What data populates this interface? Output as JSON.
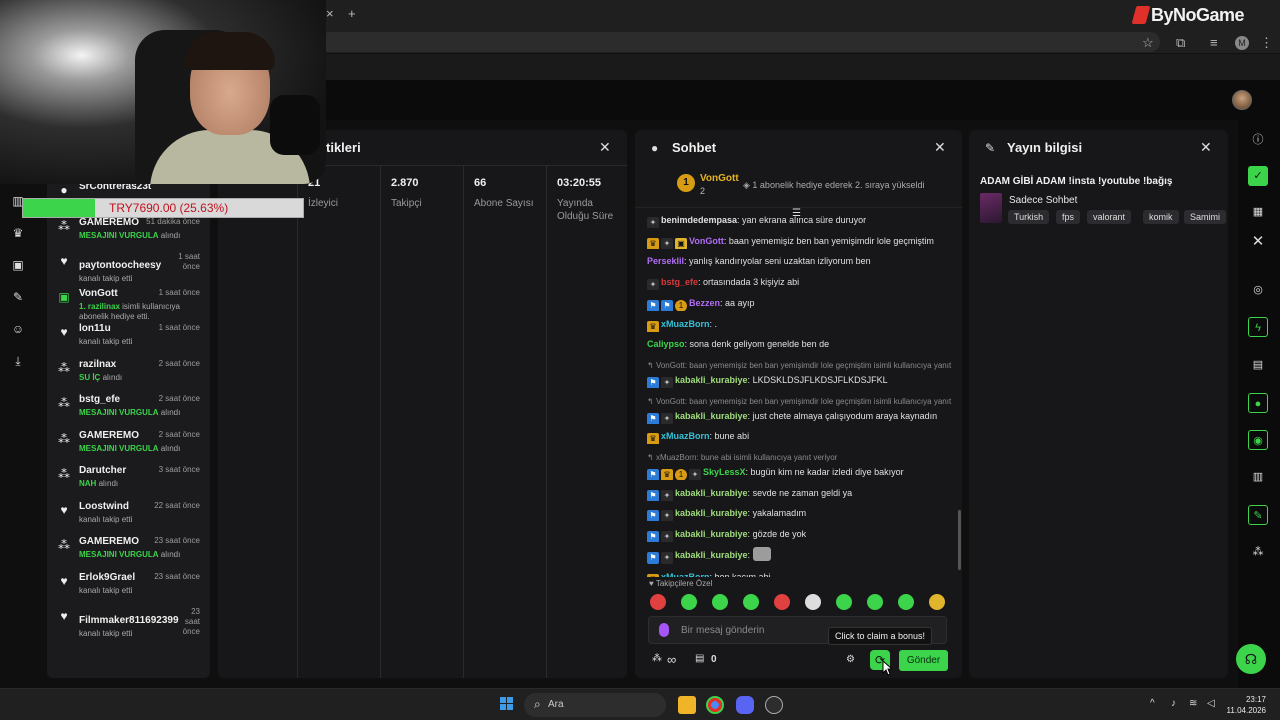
{
  "browser": {
    "brand": "ByNoGame",
    "tab_close_glyph": "×",
    "new_tab_glyph": "+",
    "profile_initial": "M"
  },
  "donation_goal": {
    "text": "TRY7690.00 (25.63%)",
    "progress_fraction": 0.2563,
    "fill_color": "#3bd44a",
    "text_color": "#c1121f"
  },
  "feed": {
    "items": [
      {
        "icon": "person-icon",
        "name": "SrContreras23t",
        "time": "",
        "desc": ""
      },
      {
        "icon": "gamepad-icon",
        "name": "GAMEREMO",
        "time": "51 dakika önce",
        "desc_highlight": "MESAJINI VURGULA",
        "desc": " alındı"
      },
      {
        "icon": "heart-icon",
        "name": "paytontoocheesy",
        "time": "1 saat önce",
        "desc": "kanalı takip etti"
      },
      {
        "icon": "gift-icon",
        "name": "VonGott",
        "time": "1 saat önce",
        "desc_highlight": "1. razilinax",
        "desc": " isimli kullanıcıya abonelik hediye etti."
      },
      {
        "icon": "heart-icon",
        "name": "lon11u",
        "time": "1 saat önce",
        "desc": "kanalı takip etti"
      },
      {
        "icon": "gamepad-icon",
        "name": "razilnax",
        "time": "2 saat önce",
        "desc_highlight": "SU İÇ",
        "desc": " alındı"
      },
      {
        "icon": "gamepad-icon",
        "name": "bstg_efe",
        "time": "2 saat önce",
        "desc_highlight": "MESAJINI VURGULA",
        "desc": " alındı"
      },
      {
        "icon": "gamepad-icon",
        "name": "GAMEREMO",
        "time": "2 saat önce",
        "desc_highlight": "MESAJINI VURGULA",
        "desc": " alındı"
      },
      {
        "icon": "gamepad-icon",
        "name": "Darutcher",
        "time": "3 saat önce",
        "desc_highlight": "NAH",
        "desc": " alındı"
      },
      {
        "icon": "heart-icon",
        "name": "Loostwind",
        "time": "22 saat önce",
        "desc": "kanalı takip etti"
      },
      {
        "icon": "gamepad-icon",
        "name": "GAMEREMO",
        "time": "23 saat önce",
        "desc_highlight": "MESAJINI VURGULA",
        "desc": " alındı"
      },
      {
        "icon": "heart-icon",
        "name": "Erlok9Grael",
        "time": "23 saat önce",
        "desc": "kanalı takip etti"
      },
      {
        "icon": "heart-icon",
        "name": "Filmmaker811692399",
        "time": "23 saat önce",
        "desc": "kanalı takip etti"
      }
    ]
  },
  "stats": {
    "title": "tikleri",
    "items": [
      {
        "value": "21",
        "label": "İzleyici"
      },
      {
        "value": "2.870",
        "label": "Takipçi"
      },
      {
        "value": "66",
        "label": "Abone Sayısı"
      },
      {
        "value": "03:20:55",
        "label": "Yayında Olduğu Süre"
      }
    ]
  },
  "chat": {
    "title": "Sohbet",
    "pinned": {
      "name": "VonGott",
      "count": "2",
      "badge": "1",
      "text": "1 abonelik hediye ederek 2. sıraya yükseldi"
    },
    "messages": [
      {
        "kind": "msg",
        "badges": [
          "ghost"
        ],
        "user": "benimdedempasa",
        "color": "#e0e0e0",
        "text": "yan ekrana alınca süre duruyor"
      },
      {
        "kind": "msg",
        "badges": [
          "crown",
          "ghost",
          "gift"
        ],
        "user": "VonGott",
        "color": "#b26cf6",
        "text": "baan yememişiz ben ban yemişimdir lole geçmiştim"
      },
      {
        "kind": "msg",
        "badges": [],
        "user": "Perseklil",
        "color": "#b26cf6",
        "text": "yanlış kandırıyolar seni uzaktan izliyorum ben"
      },
      {
        "kind": "msg",
        "badges": [
          "ghost"
        ],
        "user": "bstg_efe",
        "color": "#d83a3a",
        "text": "ortasındada 3 kişiyiz abi"
      },
      {
        "kind": "msg",
        "badges": [
          "blue",
          "blue",
          "sub"
        ],
        "user": "Bezzen",
        "color": "#b26cf6",
        "text": "aa ayıp"
      },
      {
        "kind": "msg",
        "badges": [
          "crown"
        ],
        "user": "xMuazBorn",
        "color": "#34c2d6",
        "text": "."
      },
      {
        "kind": "msg",
        "badges": [],
        "user": "Caliypso",
        "color": "#3bd44a",
        "text": "sona denk geliyom genelde ben de"
      },
      {
        "kind": "reply",
        "text": "VonGott: baan yememişiz ben ban yemişimdir lole geçmiştim isimli kullanıcıya yanıt veriyor"
      },
      {
        "kind": "msg",
        "badges": [
          "blue",
          "ghost"
        ],
        "user": "kabakli_kurabiye",
        "color": "#9fdc7a",
        "text": "LKDSKLDSJFLKDSJFLKDSJFKL"
      },
      {
        "kind": "reply",
        "text": "VonGott: baan yememişiz ben ban yemişimdir lole geçmiştim isimli kullanıcıya yanıt veriyor"
      },
      {
        "kind": "msg",
        "badges": [
          "blue",
          "ghost"
        ],
        "user": "kabakli_kurabiye",
        "color": "#9fdc7a",
        "text": "just chete almaya çalışıyodum araya kaynadın"
      },
      {
        "kind": "msg",
        "badges": [
          "crown"
        ],
        "user": "xMuazBorn",
        "color": "#34c2d6",
        "text": "bune abi"
      },
      {
        "kind": "reply",
        "text": "xMuazBorn: bune abi isimli kullanıcıya yanıt veriyor"
      },
      {
        "kind": "msg",
        "badges": [
          "blue",
          "crown",
          "sub",
          "ghost"
        ],
        "user": "SkyLessX",
        "color": "#3bd44a",
        "text": "bugün kim ne kadar izledi diye bakıyor"
      },
      {
        "kind": "msg",
        "badges": [
          "blue",
          "ghost"
        ],
        "user": "kabakli_kurabiye",
        "color": "#9fdc7a",
        "text": "sevde ne zaman geldi ya"
      },
      {
        "kind": "msg",
        "badges": [
          "blue",
          "ghost"
        ],
        "user": "kabakli_kurabiye",
        "color": "#9fdc7a",
        "text": "yakalamadım"
      },
      {
        "kind": "msg",
        "badges": [
          "blue",
          "ghost"
        ],
        "user": "kabakli_kurabiye",
        "color": "#9fdc7a",
        "text": "gözde de yok"
      },
      {
        "kind": "emote",
        "badges": [
          "blue",
          "ghost"
        ],
        "user": "kabakli_kurabiye",
        "color": "#9fdc7a",
        "text": ""
      },
      {
        "kind": "msg",
        "badges": [
          "crown"
        ],
        "user": "xMuazBorn",
        "color": "#34c2d6",
        "text": "ben kaçım abi"
      }
    ],
    "emote_label": "♥ Takipçilere Özel",
    "emotes": [
      "#e04040",
      "#3bd44a",
      "#3bd44a",
      "#3bd44a",
      "#e04040",
      "#dddddd",
      "#3bd44a",
      "#3bd44a",
      "#3bd44a",
      "#e0b42c"
    ],
    "input_placeholder": "Bir mesaj gönderin",
    "points": "∞",
    "store_count": "0",
    "send_label": "Gönder",
    "tooltip": "Click to claim a bonus!"
  },
  "info": {
    "title": "Yayın bilgisi",
    "stream_title": "ADAM GİBİ ADAM !insta !youtube !bağış",
    "category": "Sadece Sohbet",
    "tags": [
      "Turkish",
      "fps",
      "valorant",
      "komik",
      "Samimi"
    ]
  },
  "taskbar": {
    "search_label": "Ara",
    "time": "23:17",
    "date": "11.04.2026"
  },
  "colors": {
    "accent": "#3bd44a",
    "panel": "#17171a",
    "background": "#0f0f10"
  }
}
